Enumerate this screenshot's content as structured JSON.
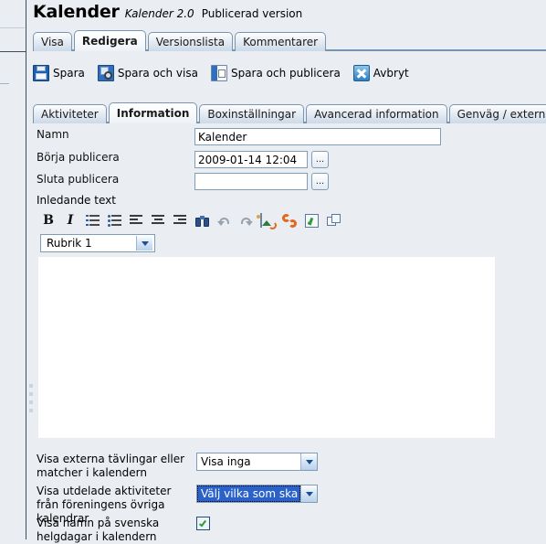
{
  "header": {
    "title": "Kalender",
    "version": "Kalender 2.0",
    "state": "Publicerad version"
  },
  "main_tabs": [
    {
      "label": "Visa",
      "active": false
    },
    {
      "label": "Redigera",
      "active": true
    },
    {
      "label": "Versionslista",
      "active": false
    },
    {
      "label": "Kommentarer",
      "active": false
    }
  ],
  "toolbar": {
    "save": "Spara",
    "save_and_view": "Spara och visa",
    "save_and_publish": "Spara och publicera",
    "cancel": "Avbryt",
    "icons": {
      "save": "floppy-disk-icon",
      "save_and_view": "floppy-magnifier-icon",
      "save_and_publish": "publish-hand-icon",
      "cancel": "blue-x-icon"
    }
  },
  "sub_tabs": [
    {
      "label": "Aktiviteter",
      "active": false
    },
    {
      "label": "Information",
      "active": true
    },
    {
      "label": "Boxinställningar",
      "active": false
    },
    {
      "label": "Avancerad information",
      "active": false
    },
    {
      "label": "Genväg / extern länk",
      "active": false
    }
  ],
  "form": {
    "name": {
      "label": "Namn",
      "value": "Kalender"
    },
    "publish_start": {
      "label": "Börja publicera",
      "value": "2009-01-14 12:04",
      "picker_label": "..."
    },
    "publish_end": {
      "label": "Sluta publicera",
      "value": "",
      "picker_label": "..."
    },
    "intro_text": {
      "label": "Inledande text",
      "body": ""
    }
  },
  "editor": {
    "style_select": {
      "value": "Rubrik 1"
    },
    "buttons": [
      {
        "name": "bold-icon",
        "title": "B"
      },
      {
        "name": "italic-icon",
        "title": "I"
      },
      {
        "name": "ordered-list-icon",
        "title": "Numrerad lista"
      },
      {
        "name": "unordered-list-icon",
        "title": "Punktlista"
      },
      {
        "name": "align-left-icon",
        "title": "Vänsterjustera"
      },
      {
        "name": "align-center-icon",
        "title": "Centrera"
      },
      {
        "name": "align-right-icon",
        "title": "Högerjustera"
      },
      {
        "name": "find-binoculars-icon",
        "title": "Sök"
      },
      {
        "name": "undo-icon",
        "title": "Ångra"
      },
      {
        "name": "redo-icon",
        "title": "Gör om"
      },
      {
        "name": "insert-image-icon",
        "title": "Infoga bild"
      },
      {
        "name": "insert-link-icon",
        "title": "Infoga länk"
      },
      {
        "name": "spellcheck-icon",
        "title": "Stavningskontroll"
      },
      {
        "name": "popup-window-icon",
        "title": "Öppna i nytt fönster"
      }
    ]
  },
  "settings": [
    {
      "label": "Visa externa tävlingar eller matcher i kalendern",
      "control": "select",
      "value": "Visa inga",
      "focused": false
    },
    {
      "label": "Visa utdelade aktiviteter från föreningens övriga kalendrar",
      "control": "select",
      "value": "Välj vilka som ska visas",
      "focused": true
    },
    {
      "label": "Visa namn på svenska helgdagar i kalendern",
      "control": "checkbox",
      "value": "checked",
      "focused": false
    }
  ],
  "colors": {
    "page_background": "#eaeef3",
    "tab_border": "#7b95b1",
    "field_border": "#7f9db9",
    "selection_blue": "#2b62c9",
    "editor_background": "#ffffff"
  }
}
